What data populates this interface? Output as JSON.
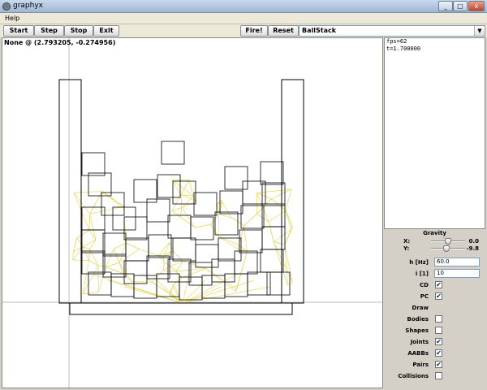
{
  "window": {
    "title": "graphyx",
    "minimize": "_",
    "maximize": "□",
    "close": "x"
  },
  "menu": {
    "help": "Help"
  },
  "toolbar": {
    "start": "Start",
    "step": "Step",
    "stop": "Stop",
    "exit": "Exit",
    "fire": "Fire!",
    "reset": "Reset"
  },
  "scene_select": {
    "value": "BallStack",
    "arrow": "▼"
  },
  "canvas": {
    "status": "None @ (2.793205, -0.274956)"
  },
  "stats": {
    "fps": "fps=62",
    "time": "t=1.700000"
  },
  "gravity": {
    "title": "Gravity",
    "x_label": "X:",
    "x_value": "0.0",
    "y_label": "Y:",
    "y_value": "-9.8",
    "x_slider_fraction": 0.5,
    "y_slider_fraction": 0.45
  },
  "settings": {
    "h_label": "h [Hz]",
    "h_value": "60.0",
    "i_label": "i [1]",
    "i_value": "10",
    "cd_label": "CD",
    "cd_checked": true,
    "pc_label": "PC",
    "pc_checked": true,
    "draw_label": "Draw",
    "bodies_label": "Bodies",
    "bodies_checked": false,
    "shapes_label": "Shapes",
    "shapes_checked": false,
    "joints_label": "Joints",
    "joints_checked": true,
    "aabbs_label": "AABBs",
    "aabbs_checked": true,
    "pairs_label": "Pairs",
    "pairs_checked": true,
    "collisions_label": "Collisions",
    "collisions_checked": false
  },
  "colors": {
    "joint_lines": "#e6d96a",
    "box_outline": "#000000"
  }
}
